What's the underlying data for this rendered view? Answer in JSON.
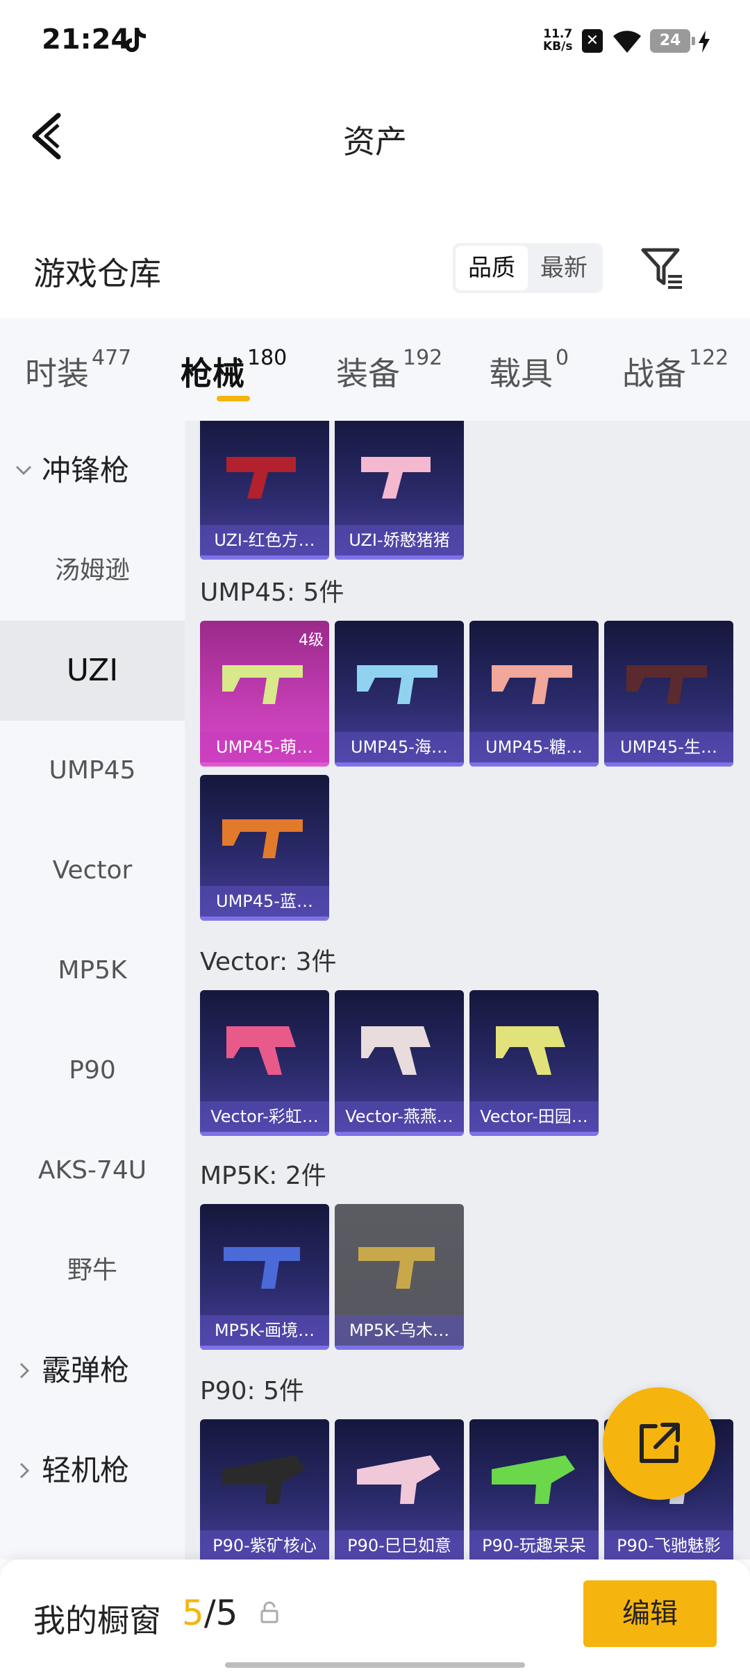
{
  "status_bar": {
    "time": "21:24",
    "net_speed_value": "11.7",
    "net_speed_unit": "KB/s",
    "battery": "24"
  },
  "header": {
    "title": "资产",
    "section_title": "游戏仓库",
    "sort_options": [
      "品质",
      "最新"
    ],
    "sort_selected": "品质"
  },
  "categories": [
    {
      "label": "时装",
      "count": "477"
    },
    {
      "label": "枪械",
      "count": "180"
    },
    {
      "label": "装备",
      "count": "192"
    },
    {
      "label": "载具",
      "count": "0"
    },
    {
      "label": "战备",
      "count": "122"
    }
  ],
  "sidebar": {
    "items": [
      {
        "label": "冲锋枪",
        "type": "group",
        "expanded": true
      },
      {
        "label": "汤姆逊"
      },
      {
        "label": "UZI",
        "active": true
      },
      {
        "label": "UMP45"
      },
      {
        "label": "Vector"
      },
      {
        "label": "MP5K"
      },
      {
        "label": "P90"
      },
      {
        "label": "AKS-74U"
      },
      {
        "label": "野牛"
      },
      {
        "label": "霰弹枪",
        "type": "group",
        "expanded": false
      },
      {
        "label": "轻机枪",
        "type": "group",
        "expanded": false
      }
    ]
  },
  "content": {
    "uzi_cards": [
      "UZI-红色方…",
      "UZI-娇憨猪猪"
    ],
    "ump45": {
      "header": "UMP45: 5件",
      "cards": [
        "UMP45-萌…",
        "UMP45-海…",
        "UMP45-糖…",
        "UMP45-生…",
        "UMP45-蓝…"
      ],
      "first_card_tier": "4级"
    },
    "vector": {
      "header": "Vector: 3件",
      "cards": [
        "Vector-彩虹…",
        "Vector-燕燕…",
        "Vector-田园…"
      ]
    },
    "mp5k": {
      "header": "MP5K: 2件",
      "cards": [
        "MP5K-画境…",
        "MP5K-乌木…"
      ]
    },
    "p90": {
      "header": "P90: 5件",
      "cards": [
        "P90-紫矿核心",
        "P90-巳巳如意",
        "P90-玩趣呆呆",
        "P90-飞驰魅影"
      ]
    }
  },
  "bottom_bar": {
    "label": "我的橱窗",
    "count_current": "5",
    "count_sep": "/",
    "count_total": "5",
    "edit_label": "编辑"
  },
  "colors": {
    "accent": "#f6b40e",
    "card_bg": "#2a2a6a",
    "card_pink": "#c43eb5"
  }
}
